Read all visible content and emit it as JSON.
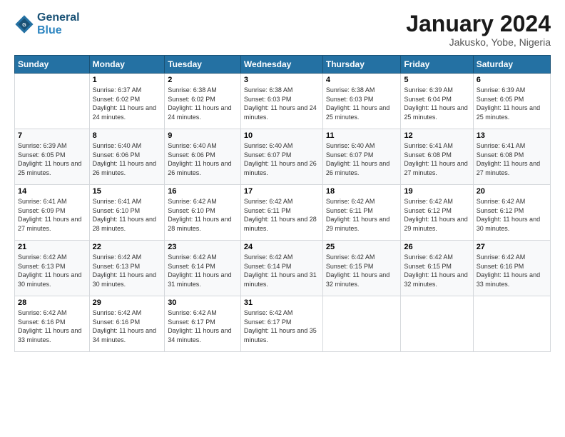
{
  "header": {
    "logo_line1": "General",
    "logo_line2": "Blue",
    "month_title": "January 2024",
    "location": "Jakusko, Yobe, Nigeria"
  },
  "days_of_week": [
    "Sunday",
    "Monday",
    "Tuesday",
    "Wednesday",
    "Thursday",
    "Friday",
    "Saturday"
  ],
  "weeks": [
    [
      {
        "day": "",
        "sunrise": "",
        "sunset": "",
        "daylight": ""
      },
      {
        "day": "1",
        "sunrise": "Sunrise: 6:37 AM",
        "sunset": "Sunset: 6:02 PM",
        "daylight": "Daylight: 11 hours and 24 minutes."
      },
      {
        "day": "2",
        "sunrise": "Sunrise: 6:38 AM",
        "sunset": "Sunset: 6:02 PM",
        "daylight": "Daylight: 11 hours and 24 minutes."
      },
      {
        "day": "3",
        "sunrise": "Sunrise: 6:38 AM",
        "sunset": "Sunset: 6:03 PM",
        "daylight": "Daylight: 11 hours and 24 minutes."
      },
      {
        "day": "4",
        "sunrise": "Sunrise: 6:38 AM",
        "sunset": "Sunset: 6:03 PM",
        "daylight": "Daylight: 11 hours and 25 minutes."
      },
      {
        "day": "5",
        "sunrise": "Sunrise: 6:39 AM",
        "sunset": "Sunset: 6:04 PM",
        "daylight": "Daylight: 11 hours and 25 minutes."
      },
      {
        "day": "6",
        "sunrise": "Sunrise: 6:39 AM",
        "sunset": "Sunset: 6:05 PM",
        "daylight": "Daylight: 11 hours and 25 minutes."
      }
    ],
    [
      {
        "day": "7",
        "sunrise": "Sunrise: 6:39 AM",
        "sunset": "Sunset: 6:05 PM",
        "daylight": "Daylight: 11 hours and 25 minutes."
      },
      {
        "day": "8",
        "sunrise": "Sunrise: 6:40 AM",
        "sunset": "Sunset: 6:06 PM",
        "daylight": "Daylight: 11 hours and 26 minutes."
      },
      {
        "day": "9",
        "sunrise": "Sunrise: 6:40 AM",
        "sunset": "Sunset: 6:06 PM",
        "daylight": "Daylight: 11 hours and 26 minutes."
      },
      {
        "day": "10",
        "sunrise": "Sunrise: 6:40 AM",
        "sunset": "Sunset: 6:07 PM",
        "daylight": "Daylight: 11 hours and 26 minutes."
      },
      {
        "day": "11",
        "sunrise": "Sunrise: 6:40 AM",
        "sunset": "Sunset: 6:07 PM",
        "daylight": "Daylight: 11 hours and 26 minutes."
      },
      {
        "day": "12",
        "sunrise": "Sunrise: 6:41 AM",
        "sunset": "Sunset: 6:08 PM",
        "daylight": "Daylight: 11 hours and 27 minutes."
      },
      {
        "day": "13",
        "sunrise": "Sunrise: 6:41 AM",
        "sunset": "Sunset: 6:08 PM",
        "daylight": "Daylight: 11 hours and 27 minutes."
      }
    ],
    [
      {
        "day": "14",
        "sunrise": "Sunrise: 6:41 AM",
        "sunset": "Sunset: 6:09 PM",
        "daylight": "Daylight: 11 hours and 27 minutes."
      },
      {
        "day": "15",
        "sunrise": "Sunrise: 6:41 AM",
        "sunset": "Sunset: 6:10 PM",
        "daylight": "Daylight: 11 hours and 28 minutes."
      },
      {
        "day": "16",
        "sunrise": "Sunrise: 6:42 AM",
        "sunset": "Sunset: 6:10 PM",
        "daylight": "Daylight: 11 hours and 28 minutes."
      },
      {
        "day": "17",
        "sunrise": "Sunrise: 6:42 AM",
        "sunset": "Sunset: 6:11 PM",
        "daylight": "Daylight: 11 hours and 28 minutes."
      },
      {
        "day": "18",
        "sunrise": "Sunrise: 6:42 AM",
        "sunset": "Sunset: 6:11 PM",
        "daylight": "Daylight: 11 hours and 29 minutes."
      },
      {
        "day": "19",
        "sunrise": "Sunrise: 6:42 AM",
        "sunset": "Sunset: 6:12 PM",
        "daylight": "Daylight: 11 hours and 29 minutes."
      },
      {
        "day": "20",
        "sunrise": "Sunrise: 6:42 AM",
        "sunset": "Sunset: 6:12 PM",
        "daylight": "Daylight: 11 hours and 30 minutes."
      }
    ],
    [
      {
        "day": "21",
        "sunrise": "Sunrise: 6:42 AM",
        "sunset": "Sunset: 6:13 PM",
        "daylight": "Daylight: 11 hours and 30 minutes."
      },
      {
        "day": "22",
        "sunrise": "Sunrise: 6:42 AM",
        "sunset": "Sunset: 6:13 PM",
        "daylight": "Daylight: 11 hours and 30 minutes."
      },
      {
        "day": "23",
        "sunrise": "Sunrise: 6:42 AM",
        "sunset": "Sunset: 6:14 PM",
        "daylight": "Daylight: 11 hours and 31 minutes."
      },
      {
        "day": "24",
        "sunrise": "Sunrise: 6:42 AM",
        "sunset": "Sunset: 6:14 PM",
        "daylight": "Daylight: 11 hours and 31 minutes."
      },
      {
        "day": "25",
        "sunrise": "Sunrise: 6:42 AM",
        "sunset": "Sunset: 6:15 PM",
        "daylight": "Daylight: 11 hours and 32 minutes."
      },
      {
        "day": "26",
        "sunrise": "Sunrise: 6:42 AM",
        "sunset": "Sunset: 6:15 PM",
        "daylight": "Daylight: 11 hours and 32 minutes."
      },
      {
        "day": "27",
        "sunrise": "Sunrise: 6:42 AM",
        "sunset": "Sunset: 6:16 PM",
        "daylight": "Daylight: 11 hours and 33 minutes."
      }
    ],
    [
      {
        "day": "28",
        "sunrise": "Sunrise: 6:42 AM",
        "sunset": "Sunset: 6:16 PM",
        "daylight": "Daylight: 11 hours and 33 minutes."
      },
      {
        "day": "29",
        "sunrise": "Sunrise: 6:42 AM",
        "sunset": "Sunset: 6:16 PM",
        "daylight": "Daylight: 11 hours and 34 minutes."
      },
      {
        "day": "30",
        "sunrise": "Sunrise: 6:42 AM",
        "sunset": "Sunset: 6:17 PM",
        "daylight": "Daylight: 11 hours and 34 minutes."
      },
      {
        "day": "31",
        "sunrise": "Sunrise: 6:42 AM",
        "sunset": "Sunset: 6:17 PM",
        "daylight": "Daylight: 11 hours and 35 minutes."
      },
      {
        "day": "",
        "sunrise": "",
        "sunset": "",
        "daylight": ""
      },
      {
        "day": "",
        "sunrise": "",
        "sunset": "",
        "daylight": ""
      },
      {
        "day": "",
        "sunrise": "",
        "sunset": "",
        "daylight": ""
      }
    ]
  ]
}
